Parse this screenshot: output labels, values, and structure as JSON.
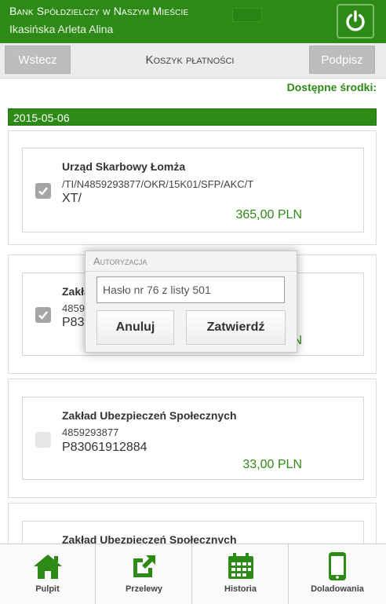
{
  "header": {
    "bank_name": "Bank Spółdzielczy w Naszym Mieście",
    "user_name": "Ikasińska Arleta Alina"
  },
  "toolbar": {
    "back_label": "Wstecz",
    "title": "Koszyk płatności",
    "sign_label": "Podpisz"
  },
  "funds_label": "Dostępne środki:",
  "date": "2015-05-06",
  "payments": [
    {
      "checked": true,
      "recipient": "Urząd Skarbowy Łomża",
      "account_line1": "/TI/N4859293877/OKR/15K01/SFP/AKC/T",
      "account_line2": "XT/",
      "amount": "365,00 PLN"
    },
    {
      "checked": true,
      "recipient": "Zakła",
      "account_line1": "4859",
      "account_line2": "P83",
      "amount": "N"
    },
    {
      "checked": false,
      "recipient": "Zakład Ubezpieczeń Społecznych",
      "account_line1": "4859293877",
      "account_line2": "P83061912884",
      "amount": "33,00 PLN"
    },
    {
      "checked": false,
      "recipient": "Zakład Ubezpieczeń Społecznych",
      "account_line1": "",
      "account_line2": "",
      "amount": ""
    }
  ],
  "modal": {
    "title": "Autoryzacja",
    "input_placeholder": "Hasło nr 76 z listy 501",
    "cancel_label": "Anuluj",
    "confirm_label": "Zatwierdź"
  },
  "nav": [
    {
      "label": "Pulpit",
      "icon": "home-icon"
    },
    {
      "label": "Przelewy",
      "icon": "transfer-icon"
    },
    {
      "label": "Historia",
      "icon": "calendar-icon"
    },
    {
      "label": "Doladowania",
      "icon": "phone-icon"
    }
  ],
  "colors": {
    "brand_green": "#2e8a17",
    "disabled_button": "#bdbdbd"
  }
}
